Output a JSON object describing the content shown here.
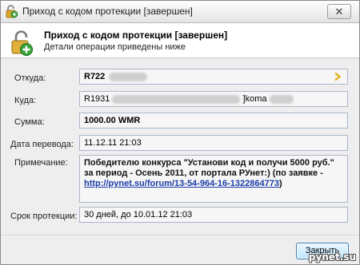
{
  "window": {
    "title": "Приход с кодом протекции [завершен]",
    "close_glyph": "✕"
  },
  "header": {
    "title": "Приход с кодом протекции [завершен]",
    "subtitle": "Детали операции приведены ниже",
    "icon": "unlocked-padlock-plus-icon"
  },
  "fields": {
    "from": {
      "label": "Откуда:",
      "value": "R722"
    },
    "to": {
      "label": "Куда:",
      "value_prefix": "R1931",
      "value_suffix": "]koma"
    },
    "amount": {
      "label": "Сумма:",
      "value": "1000.00 WMR"
    },
    "date": {
      "label": "Дата перевода:",
      "value": "11.12.11 21:03"
    },
    "note": {
      "label": "Примечание:",
      "text": "Победителю конкурса \"Установи код и получи 5000 руб.\" за период - Осень 2011, от портала РУнет:) (по заявке - ",
      "link": "http://pynet.su/forum/13-54-964-16-1322864773",
      "text_end": ")"
    },
    "protection": {
      "label": "Срок протекции:",
      "value": "30 дней, до 10.01.12 21:03"
    }
  },
  "buttons": {
    "close": "Закрыть"
  },
  "watermark": "pynet.su",
  "colors": {
    "accent": "#3c7fb1",
    "link": "#1a3ca8",
    "icon_green": "#3aa33a",
    "arrow_yellow": "#e0b21a"
  }
}
